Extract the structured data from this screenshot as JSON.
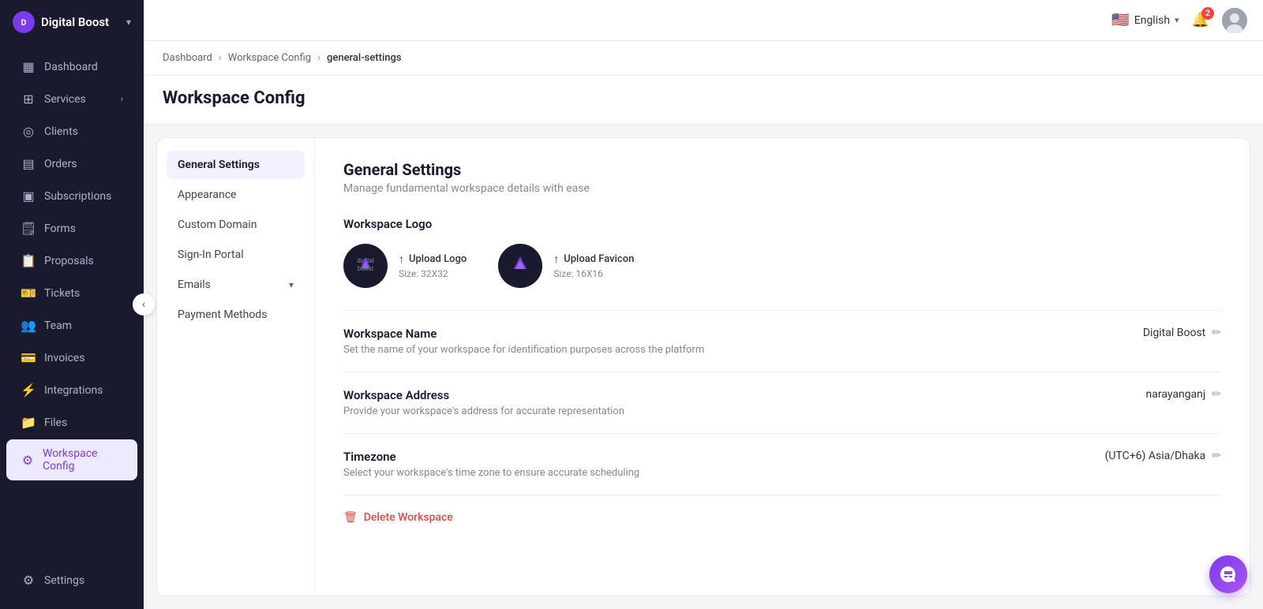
{
  "app": {
    "name": "Digital Boost",
    "logo_letter": "D"
  },
  "topbar": {
    "language": "English",
    "flag": "🇺🇸",
    "notification_count": "2"
  },
  "sidebar": {
    "items": [
      {
        "id": "dashboard",
        "label": "Dashboard",
        "icon": "▦"
      },
      {
        "id": "services",
        "label": "Services",
        "icon": "⊞",
        "has_chevron": true
      },
      {
        "id": "clients",
        "label": "Clients",
        "icon": "◎"
      },
      {
        "id": "orders",
        "label": "Orders",
        "icon": "▤"
      },
      {
        "id": "subscriptions",
        "label": "Subscriptions",
        "icon": "▣"
      },
      {
        "id": "forms",
        "label": "Forms",
        "icon": "📄"
      },
      {
        "id": "proposals",
        "label": "Proposals",
        "icon": "📋"
      },
      {
        "id": "tickets",
        "label": "Tickets",
        "icon": "🎫"
      },
      {
        "id": "team",
        "label": "Team",
        "icon": "👥"
      },
      {
        "id": "invoices",
        "label": "Invoices",
        "icon": "💳"
      },
      {
        "id": "integrations",
        "label": "Integrations",
        "icon": "⚡"
      },
      {
        "id": "files",
        "label": "Files",
        "icon": "📁"
      },
      {
        "id": "workspace-config",
        "label": "Workspace Config",
        "icon": "⚙"
      }
    ],
    "bottom": {
      "settings_label": "Settings",
      "settings_icon": "⚙"
    }
  },
  "breadcrumb": {
    "items": [
      "Dashboard",
      "Workspace Config",
      "general-settings"
    ]
  },
  "page": {
    "title": "Workspace Config"
  },
  "ws_sidenav": {
    "items": [
      {
        "id": "general",
        "label": "General Settings",
        "active": true
      },
      {
        "id": "appearance",
        "label": "Appearance"
      },
      {
        "id": "custom-domain",
        "label": "Custom Domain"
      },
      {
        "id": "sign-in-portal",
        "label": "Sign-In Portal"
      },
      {
        "id": "emails",
        "label": "Emails",
        "has_chevron": true
      },
      {
        "id": "payment-methods",
        "label": "Payment Methods"
      }
    ]
  },
  "general_settings": {
    "title": "General Settings",
    "subtitle": "Manage fundamental workspace details with ease",
    "logo_section_label": "Workspace Logo",
    "upload_logo_label": "Upload Logo",
    "logo_size": "Size: 32X32",
    "upload_favicon_label": "Upload Favicon",
    "favicon_size": "Size: 16X16",
    "fields": [
      {
        "id": "workspace-name",
        "label": "Workspace Name",
        "desc": "Set the name of your workspace for identification purposes across the platform",
        "value": "Digital Boost"
      },
      {
        "id": "workspace-address",
        "label": "Workspace Address",
        "desc": "Provide your workspace's address for accurate representation",
        "value": "narayanganj"
      },
      {
        "id": "timezone",
        "label": "Timezone",
        "desc": "Select your workspace's time zone to ensure accurate scheduling",
        "value": "(UTC+6) Asia/Dhaka"
      }
    ],
    "delete_workspace_label": "Delete Workspace"
  }
}
